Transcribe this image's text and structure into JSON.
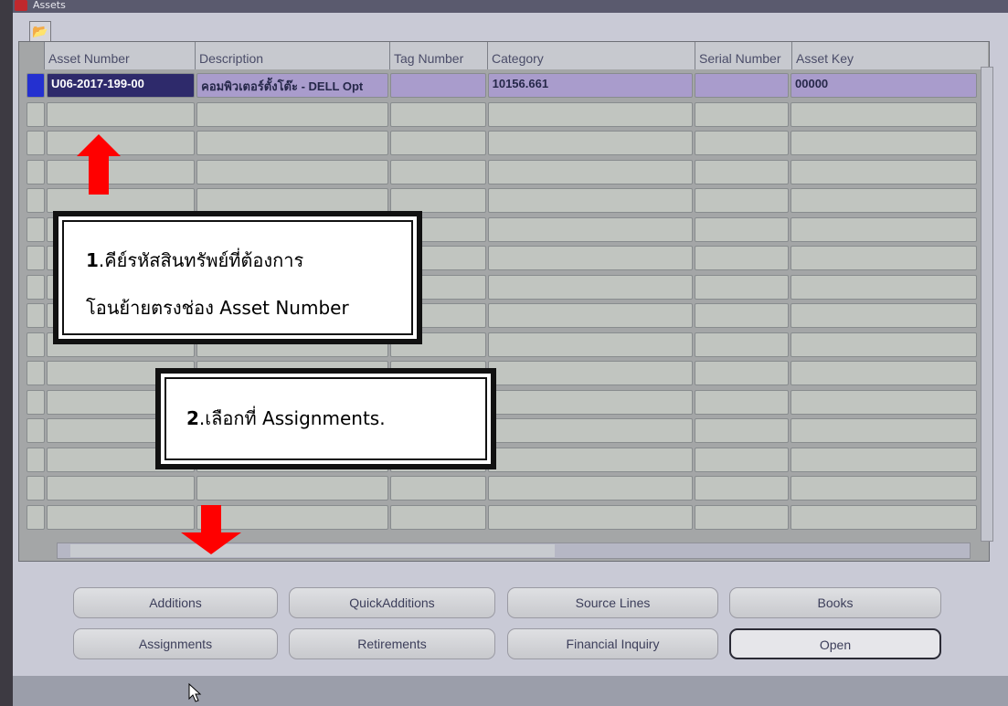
{
  "window": {
    "title": "Assets"
  },
  "grid": {
    "columns": [
      "Asset Number",
      "Description",
      "Tag Number",
      "Category",
      "Serial Number",
      "Asset Key"
    ],
    "rows": [
      {
        "asset_number": "U06-2017-199-00",
        "description": "คอมพิวเตอร์ตั้งโต๊ะ - DELL Opt",
        "tag_number": "",
        "category": "10156.661",
        "serial_number": "",
        "asset_key": "00000"
      }
    ]
  },
  "buttons": {
    "additions": "Additions",
    "quick_additions": "QuickAdditions",
    "source_lines": "Source Lines",
    "books": "Books",
    "assignments": "Assignments",
    "retirements": "Retirements",
    "financial_inquiry": "Financial Inquiry",
    "open": "Open"
  },
  "annotations": {
    "note1_num": "1",
    "note1_line1": ".คีย์รหัสสินทรัพย์ที่ต้องการ",
    "note1_line2": "โอนย้ายตรงช่อง Asset Number",
    "note2_num": "2",
    "note2_text": ".เลือกที่ Assignments."
  },
  "colors": {
    "accent": "#ff0000",
    "row_highlight": "#a99ccc",
    "selected_cell": "#2e2a6b"
  }
}
